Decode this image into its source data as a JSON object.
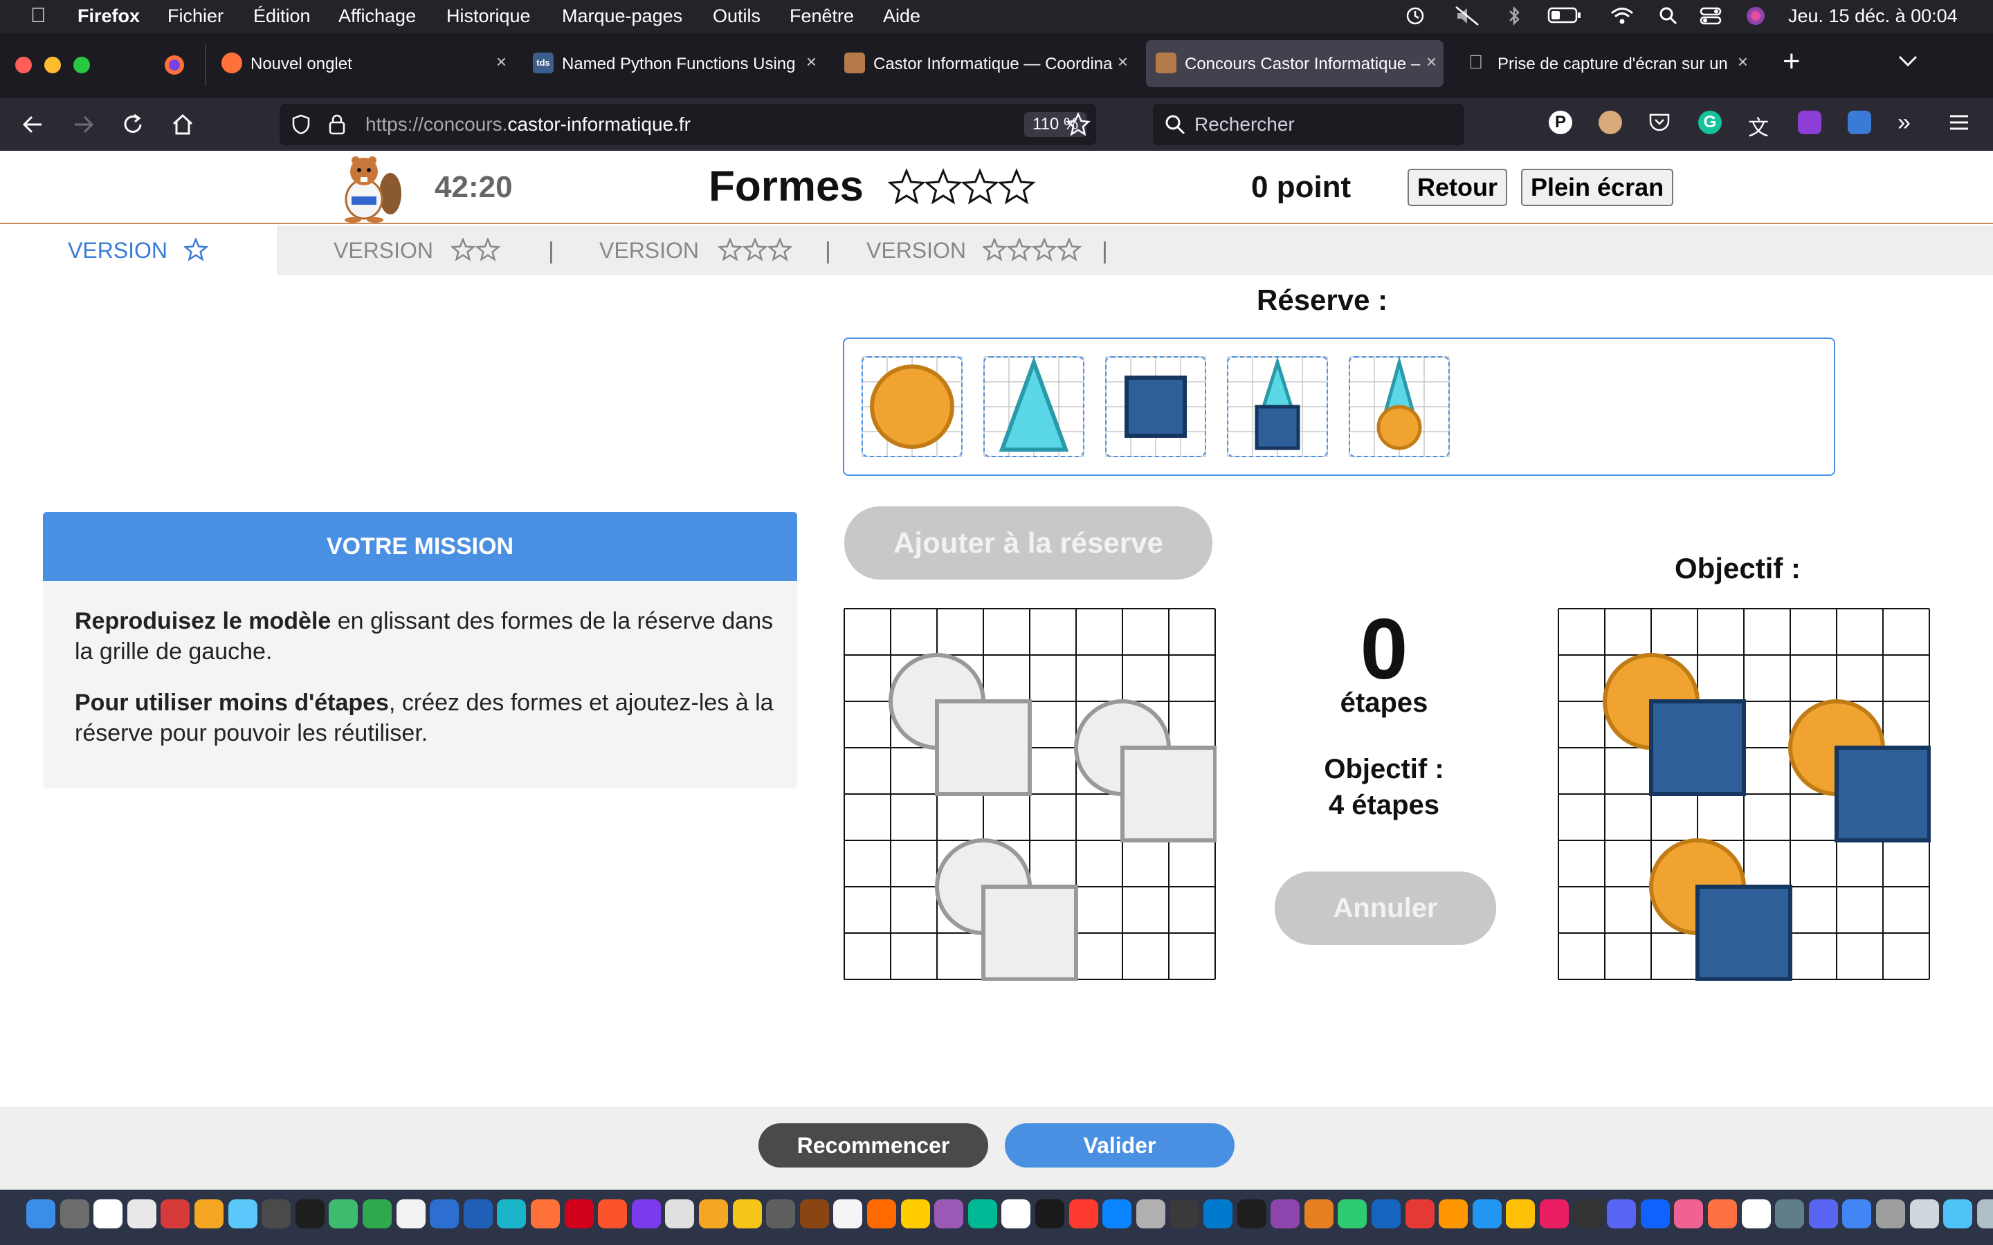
{
  "menubar": {
    "app": "Firefox",
    "items": [
      "Fichier",
      "Édition",
      "Affichage",
      "Historique",
      "Marque-pages",
      "Outils",
      "Fenêtre",
      "Aide"
    ],
    "clock": "Jeu. 15 déc. à  00:04"
  },
  "tabs": [
    {
      "label": "Nouvel onglet",
      "favicon_color": "#ff7139"
    },
    {
      "label": "Named Python Functions Using",
      "favicon_color": "#3b5f8a"
    },
    {
      "label": "Castor Informatique — Coordina",
      "favicon_color": "#b57a4a"
    },
    {
      "label": "Concours Castor Informatique –",
      "favicon_color": "#b57a4a"
    },
    {
      "label": "Prise de capture d'écran sur un",
      "favicon_color": "#cccccc"
    }
  ],
  "navbar": {
    "url_prefix": "https://concours.",
    "url_domain": "castor-informatique.fr",
    "zoom": "110 %",
    "search_placeholder": "Rechercher"
  },
  "page": {
    "timer": "42:20",
    "title": "Formes",
    "points": "0 point",
    "back_label": "Retour",
    "fullscreen_label": "Plein écran",
    "versions": [
      {
        "label": "VERSION",
        "stars": 1
      },
      {
        "label": "VERSION",
        "stars": 2
      },
      {
        "label": "VERSION",
        "stars": 3
      },
      {
        "label": "VERSION",
        "stars": 4
      }
    ],
    "version_separator": "|",
    "reserve_title": "Réserve :",
    "mission_title": "VOTRE MISSION",
    "mission_p1_bold": "Reproduisez le modèle",
    "mission_p1_rest": " en glissant des formes de la réserve dans la grille de gauche.",
    "mission_p2_bold": "Pour utiliser moins d'étapes",
    "mission_p2_rest": ", créez des formes et ajoutez-les à la réserve pour pouvoir les réutiliser.",
    "add_to_reserve_label": "Ajouter à la réserve",
    "steps_count": "0",
    "steps_label": "étapes",
    "objective_steps_line1": "Objectif :",
    "objective_steps_line2": "4 étapes",
    "cancel_label": "Annuler",
    "objective_title": "Objectif :",
    "restart_label": "Recommencer",
    "validate_label": "Valider",
    "reserve_items": [
      "circle",
      "triangle",
      "square",
      "triangle-on-square",
      "triangle-on-circle"
    ]
  },
  "colors": {
    "orange": "#f0a330",
    "orange_stroke": "#c27c16",
    "blue": "#2f5f98",
    "blue_stroke": "#15365e",
    "cyan": "#5bd8e8",
    "cyan_stroke": "#2a9aaa",
    "accent": "#4a90e2",
    "ghost_fill": "#eeeeee",
    "ghost_stroke": "#999999"
  }
}
